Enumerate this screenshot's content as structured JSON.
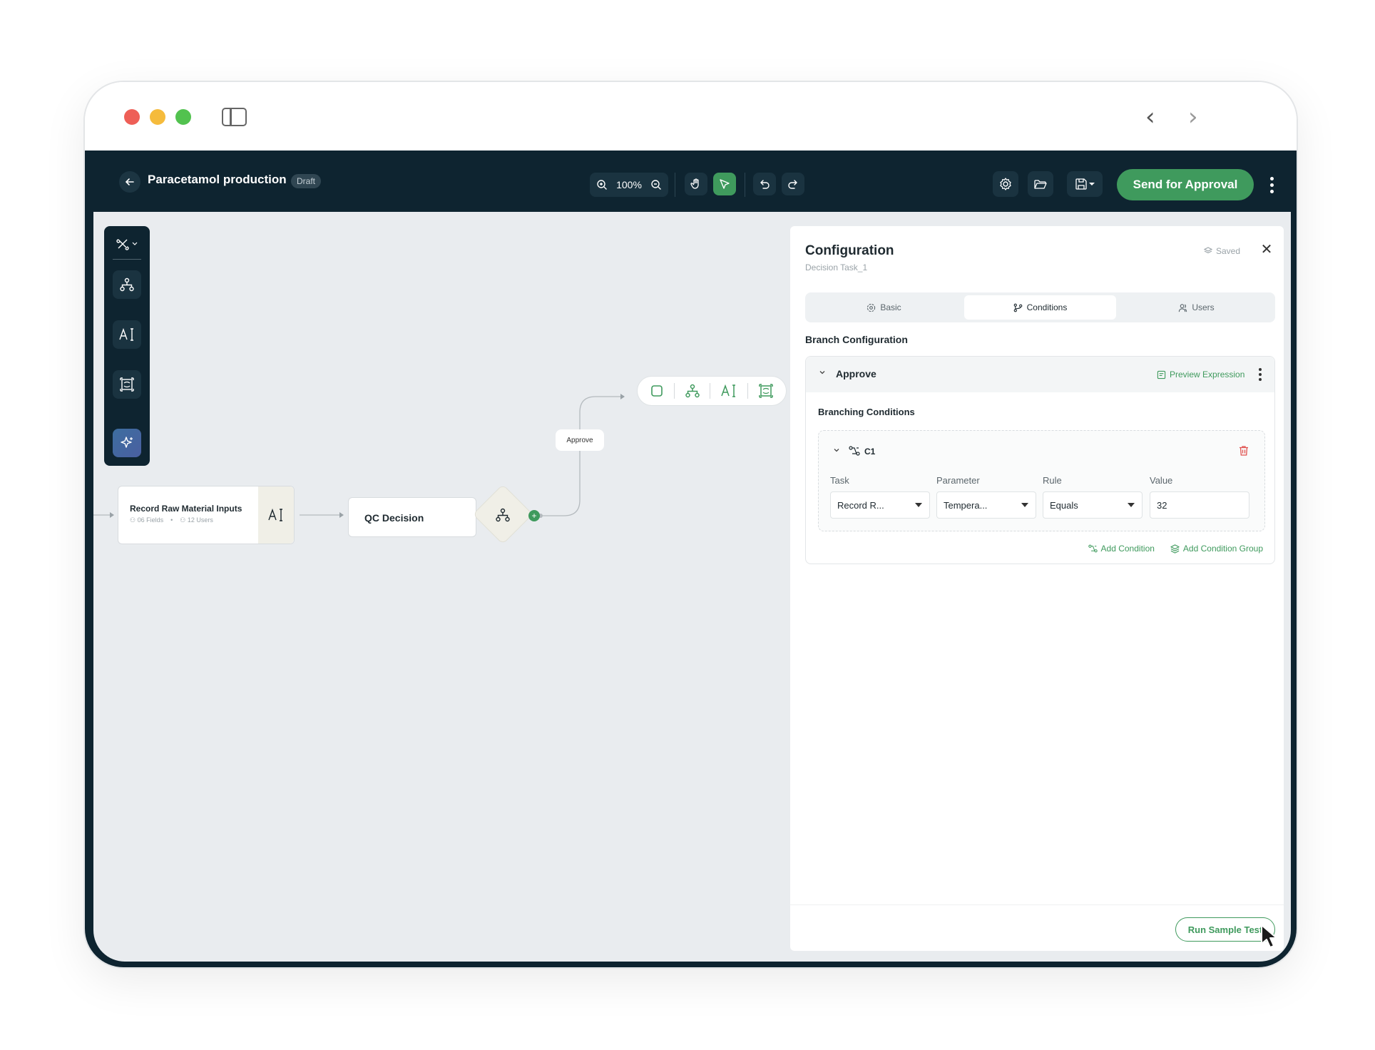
{
  "app": {
    "project_title": "Paracetamol production",
    "status_badge": "Draft",
    "zoom_level": "100%",
    "send_button": "Send for Approval"
  },
  "canvas": {
    "nodes": {
      "record": {
        "title": "Record Raw Material Inputs",
        "fields": "06 Fields",
        "users": "12 Users"
      },
      "qc": {
        "title": "QC Decision"
      }
    },
    "edge_label": "Approve",
    "add_symbol": "+"
  },
  "config": {
    "title": "Configuration",
    "subtitle": "Decision Task_1",
    "saved": "Saved",
    "tabs": [
      {
        "label": "Basic",
        "icon": "gear-icon"
      },
      {
        "label": "Conditions",
        "icon": "branch-icon",
        "active": true
      },
      {
        "label": "Users",
        "icon": "users-icon"
      }
    ],
    "section_title": "Branch Configuration",
    "branch": {
      "name": "Approve",
      "preview_label": "Preview Expression",
      "conditions_title": "Branching Conditions",
      "condition": {
        "id": "C1",
        "labels": {
          "task": "Task",
          "parameter": "Parameter",
          "rule": "Rule",
          "value": "Value"
        },
        "values": {
          "task": "Record R...",
          "parameter": "Tempera...",
          "rule": "Equals",
          "value": "32"
        }
      },
      "add_condition": "Add Condition",
      "add_condition_group": "Add Condition Group"
    },
    "run_button": "Run Sample Test"
  },
  "colors": {
    "accent_green": "#3f9a5d",
    "dark_navy": "#0e2430",
    "canvas_bg": "#e9ecef",
    "danger_red": "#e0524f"
  }
}
